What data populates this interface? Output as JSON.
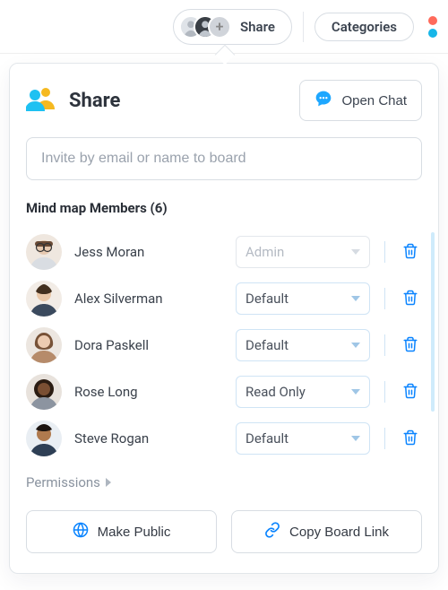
{
  "topbar": {
    "share_label": "Share",
    "categories_label": "Categories"
  },
  "panel": {
    "title": "Share",
    "open_chat_label": "Open Chat",
    "invite_placeholder": "Invite by email or name to board",
    "members_heading": "Mind map Members (6)",
    "members": [
      {
        "name": "Jess Moran",
        "role": "Admin",
        "role_disabled": true
      },
      {
        "name": "Alex Silverman",
        "role": "Default",
        "role_disabled": false
      },
      {
        "name": "Dora Paskell",
        "role": "Default",
        "role_disabled": false
      },
      {
        "name": "Rose Long",
        "role": "Read Only",
        "role_disabled": false
      },
      {
        "name": "Steve Rogan",
        "role": "Default",
        "role_disabled": false
      }
    ],
    "permissions_label": "Permissions",
    "make_public_label": "Make Public",
    "copy_link_label": "Copy Board Link"
  },
  "colors": {
    "accent": "#0a84ff",
    "yellow": "#f5b921"
  }
}
